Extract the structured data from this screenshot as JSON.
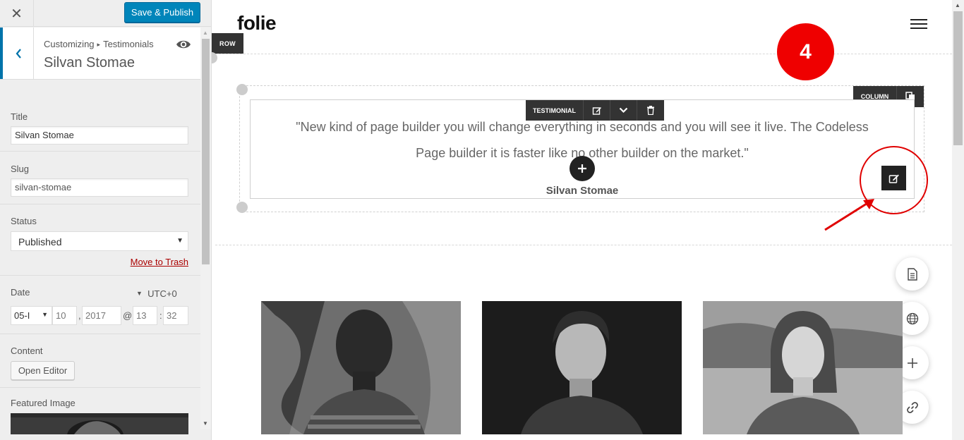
{
  "sidebar": {
    "close_label": "✕",
    "publish_label": "Save & Publish",
    "breadcrumb": {
      "parent": "Customizing",
      "separator": "▸",
      "section": "Testimonials"
    },
    "title": "Silvan Stomae",
    "fields": {
      "title": {
        "label": "Title",
        "value": "Silvan Stomae"
      },
      "slug": {
        "label": "Slug",
        "value": "silvan-stomae"
      },
      "status": {
        "label": "Status",
        "selected": "Published",
        "trash_link": "Move to Trash"
      },
      "date": {
        "label": "Date",
        "timezone": "UTC+0",
        "month": "05-I",
        "day": "10",
        "year": "2017",
        "at": "@",
        "hour": "13",
        "colon": ":",
        "minute": "32",
        "comma": ","
      },
      "content": {
        "label": "Content",
        "button": "Open Editor"
      },
      "featured_image": {
        "label": "Featured Image"
      }
    }
  },
  "preview": {
    "logo": "folie",
    "row_tag": "ROW",
    "column_tag": "COLUMN",
    "testimonial_tag": "TESTIMONIAL",
    "step_number": "4",
    "quote_line1": "\"New kind of page builder you will change everything in seconds and you will see it live. The Codeless",
    "quote_line2": "Page builder it is faster like no other builder on the market.\"",
    "author": "Silvan Stomae",
    "fab_icons": [
      "document-icon",
      "globe-icon",
      "plus-icon",
      "link-icon"
    ]
  },
  "colors": {
    "accent": "#0085ba",
    "annotation": "#e00000",
    "toolbar": "#333333"
  }
}
